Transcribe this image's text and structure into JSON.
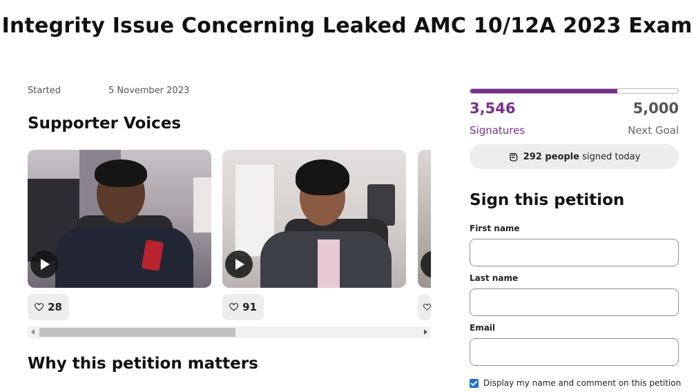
{
  "petition": {
    "title": "Integrity Issue Concerning Leaked AMC 10/12A 2023 Exam",
    "started_label": "Started",
    "started_date": "5 November 2023"
  },
  "voices": {
    "heading": "Supporter Voices",
    "cards": [
      {
        "likes": "28",
        "icon": "play-icon"
      },
      {
        "likes": "91",
        "icon": "play-icon"
      },
      {
        "likes": "",
        "icon": "play-icon"
      }
    ]
  },
  "why": {
    "heading": "Why this petition matters"
  },
  "signatures": {
    "count": "3,546",
    "count_label": "Signatures",
    "goal": "5,000",
    "goal_label": "Next Goal",
    "progress_fraction": 0.709,
    "today_count": "292 people",
    "today_suffix": "signed today"
  },
  "sign_form": {
    "heading": "Sign this petition",
    "first_name_label": "First name",
    "first_name_value": "",
    "last_name_label": "Last name",
    "last_name_value": "",
    "email_label": "Email",
    "email_value": "",
    "display_checkbox_label": "Display my name and comment on this petition",
    "display_checked": true
  },
  "colors": {
    "brand_purple": "#7a2e8f",
    "checkbox_blue": "#1f6fd1"
  }
}
